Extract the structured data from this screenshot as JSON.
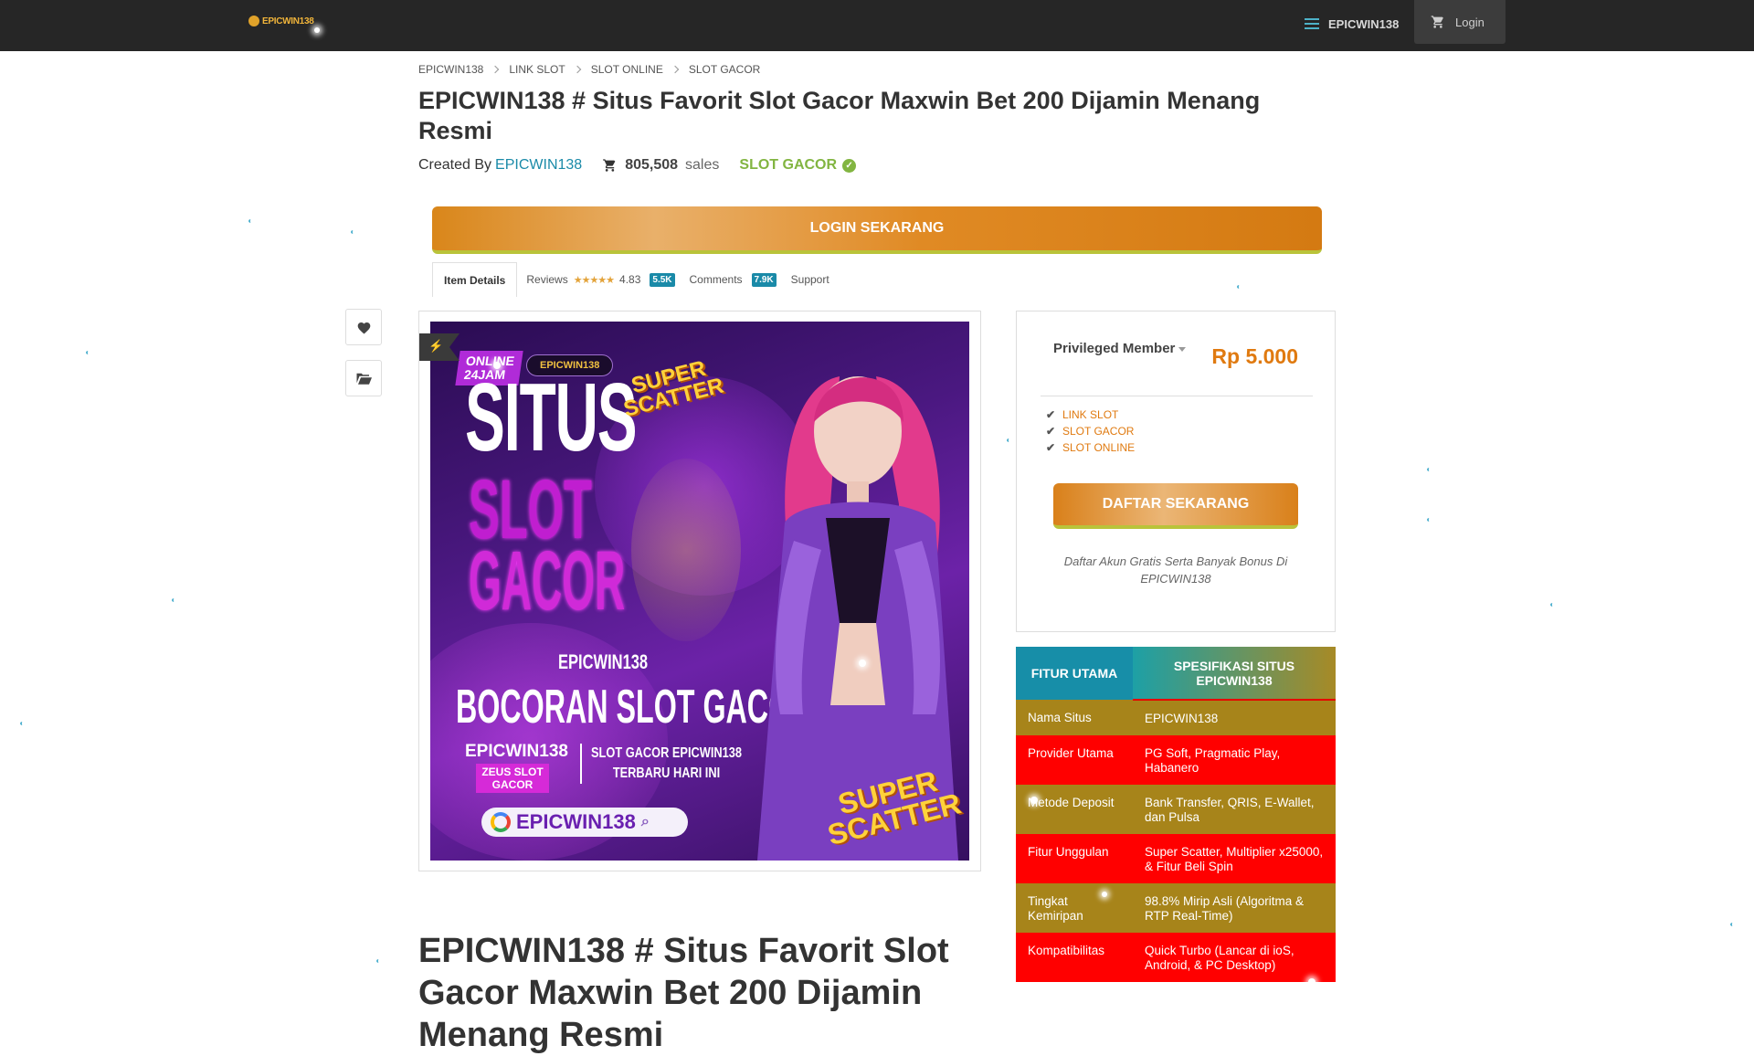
{
  "header": {
    "logo_text": "EPICWIN138",
    "brand_link": "EPICWIN138",
    "login_label": "Login"
  },
  "breadcrumb": [
    "EPICWIN138",
    "LINK SLOT",
    "SLOT ONLINE",
    "SLOT GACOR"
  ],
  "title": "EPICWIN138 # Situs Favorit Slot Gacor Maxwin Bet 200 Dijamin Menang Resmi",
  "meta": {
    "created_by_label": "Created By",
    "creator": "EPICWIN138",
    "sales_count": "805,508",
    "sales_word": "sales",
    "category": "SLOT GACOR"
  },
  "login_cta": "LOGIN SEKARANG",
  "tabs": {
    "item_details": "Item Details",
    "reviews": "Reviews",
    "rating": "4.83",
    "reviews_count": "5.5K",
    "comments": "Comments",
    "comments_count": "7.9K",
    "support": "Support"
  },
  "banner": {
    "online_line1": "ONLINE",
    "online_line2": "24JAM",
    "chip": "EPICWIN138",
    "situs": "SITUS",
    "slot": "SLOT",
    "gacor": "GACOR",
    "brand": "EPICWIN138",
    "bocoran": "BOCORAN SLOT GACOR",
    "brand_small": "EPICWIN138",
    "zeus_line1": "ZEUS SLOT",
    "zeus_line2": "GACOR",
    "right_line1": "SLOT GACOR EPICWIN138",
    "right_line2": "TERBARU HARI INI",
    "search": "EPICWIN138",
    "super_top_line1": "SUPER",
    "super_top_line2": "SCATTER",
    "super_bottom_line1": "SUPER",
    "super_bottom_line2": "SCATTER"
  },
  "pricing": {
    "plan": "Privileged Member",
    "price": "Rp 5.000",
    "features": [
      "LINK SLOT",
      "SLOT GACOR",
      "SLOT ONLINE"
    ],
    "cta": "DAFTAR SEKARANG",
    "note": "Daftar Akun Gratis Serta Banyak Bonus Di EPICWIN138"
  },
  "spec_table": {
    "col1": "FITUR UTAMA",
    "col2": "SPESIFIKASI SITUS EPICWIN138",
    "rows": [
      {
        "k": "Nama Situs",
        "v": "EPICWIN138"
      },
      {
        "k": "Provider Utama",
        "v": "PG Soft, Pragmatic Play, Habanero"
      },
      {
        "k": "Metode Deposit",
        "v": "Bank Transfer, QRIS, E-Wallet, dan Pulsa"
      },
      {
        "k": "Fitur Unggulan",
        "v": "Super Scatter, Multiplier x25000, & Fitur Beli Spin"
      },
      {
        "k": "Tingkat Kemiripan",
        "v": "98.8% Mirip Asli (Algoritma & RTP Real-Time)"
      },
      {
        "k": "Kompatibilitas",
        "v": "Quick Turbo (Lancar di ioS, Android, & PC Desktop)"
      }
    ]
  },
  "lower_title": "EPICWIN138 # Situs Favorit Slot Gacor Maxwin Bet 200 Dijamin Menang Resmi",
  "colors": {
    "topbar": "#262626",
    "accent_teal": "#1a8aa8",
    "accent_orange": "#e07a10",
    "gacor_green": "#82b541",
    "table_gold": "#a7841a",
    "table_red": "#ff0000"
  },
  "icons": [
    "list-icon",
    "cart-icon",
    "chevron-right-icon",
    "check-circle-icon",
    "heart-icon",
    "folder-icon",
    "lightning-icon",
    "check-icon",
    "caret-down-icon",
    "google-icon",
    "magnifier-icon"
  ]
}
